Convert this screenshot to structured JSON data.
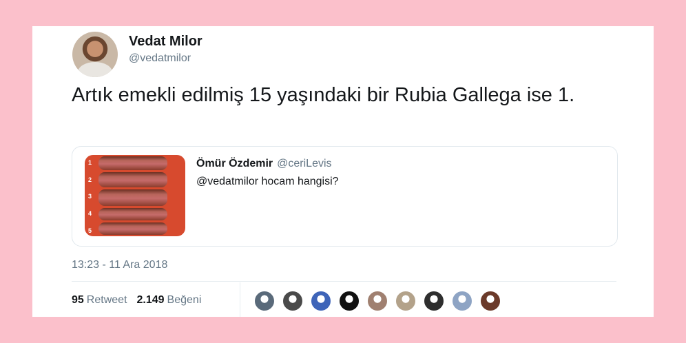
{
  "tweet": {
    "author_name": "Vedat Milor",
    "author_handle": "@vedatmilor",
    "text": "Artık emekli edilmiş 15 yaşındaki bir Rubia Gallega ise 1.",
    "timestamp": "13:23 - 11 Ara 2018"
  },
  "quoted": {
    "author_name": "Ömür Özdemir",
    "author_handle": "@ceriLevis",
    "text": "@vedatmilor hocam hangisi?",
    "image_numbers": [
      "1",
      "2",
      "3",
      "4",
      "5"
    ]
  },
  "stats": {
    "retweet_count": "95",
    "retweet_label": "Retweet",
    "like_count": "2.149",
    "like_label": "Beğeni"
  },
  "likers": [
    {
      "icon": "liker-avatar",
      "color": "#5a6a7a"
    },
    {
      "icon": "liker-avatar",
      "color": "#4a4a4a"
    },
    {
      "icon": "liker-avatar",
      "color": "#3e64b8"
    },
    {
      "icon": "batman-avatar",
      "color": "#111111"
    },
    {
      "icon": "liker-avatar",
      "color": "#a08070"
    },
    {
      "icon": "liker-avatar",
      "color": "#b3a28a"
    },
    {
      "icon": "liker-avatar",
      "color": "#2e2e2e"
    },
    {
      "icon": "liker-avatar",
      "color": "#8ea4c4"
    },
    {
      "icon": "liker-avatar",
      "color": "#6b3a2a"
    }
  ],
  "colors": {
    "background": "#fbc0cb",
    "card": "#ffffff",
    "text": "#14171a",
    "secondary": "#657786",
    "border": "#e1e8ed"
  }
}
